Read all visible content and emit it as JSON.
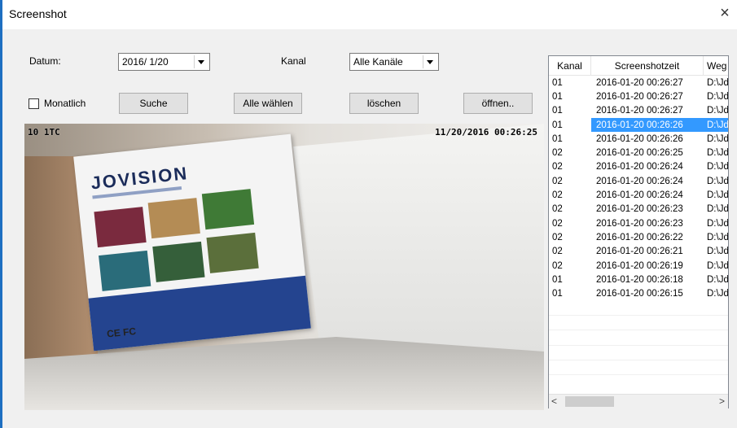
{
  "window": {
    "title": "Screenshot",
    "close_glyph": "×"
  },
  "filters": {
    "date_label": "Datum:",
    "date_value": "2016/ 1/20",
    "channel_label": "Kanal",
    "channel_value": "Alle Kanäle",
    "monthly_label": "Monatlich"
  },
  "buttons": {
    "search": "Suche",
    "select_all": "Alle wählen",
    "delete": "löschen",
    "open": "öffnen.."
  },
  "preview": {
    "osd_left": "10 1TC",
    "osd_right": "11/20/2016 00:26:25",
    "box_brand": "JOVISION",
    "box_marks": "CE FC"
  },
  "table": {
    "columns": [
      "Kanal",
      "Screenshotzeit",
      "Weg"
    ],
    "rows": [
      {
        "channel": "01",
        "time": "2016-01-20 00:26:27",
        "path": "D:\\Jd"
      },
      {
        "channel": "01",
        "time": "2016-01-20 00:26:27",
        "path": "D:\\Jd"
      },
      {
        "channel": "01",
        "time": "2016-01-20 00:26:27",
        "path": "D:\\Jd"
      },
      {
        "channel": "01",
        "time": "2016-01-20 00:26:26",
        "path": "D:\\Jd"
      },
      {
        "channel": "01",
        "time": "2016-01-20 00:26:26",
        "path": "D:\\Jd"
      },
      {
        "channel": "02",
        "time": "2016-01-20 00:26:25",
        "path": "D:\\Jd"
      },
      {
        "channel": "02",
        "time": "2016-01-20 00:26:24",
        "path": "D:\\Jd"
      },
      {
        "channel": "02",
        "time": "2016-01-20 00:26:24",
        "path": "D:\\Jd"
      },
      {
        "channel": "02",
        "time": "2016-01-20 00:26:24",
        "path": "D:\\Jd"
      },
      {
        "channel": "02",
        "time": "2016-01-20 00:26:23",
        "path": "D:\\Jd"
      },
      {
        "channel": "02",
        "time": "2016-01-20 00:26:23",
        "path": "D:\\Jd"
      },
      {
        "channel": "02",
        "time": "2016-01-20 00:26:22",
        "path": "D:\\Jd"
      },
      {
        "channel": "02",
        "time": "2016-01-20 00:26:21",
        "path": "D:\\Jd"
      },
      {
        "channel": "02",
        "time": "2016-01-20 00:26:19",
        "path": "D:\\Jd"
      },
      {
        "channel": "01",
        "time": "2016-01-20 00:26:18",
        "path": "D:\\Jd"
      },
      {
        "channel": "01",
        "time": "2016-01-20 00:26:15",
        "path": "D:\\Jd"
      }
    ],
    "selected_row_number": 4,
    "scroll_left": "<",
    "scroll_right": ">"
  },
  "colors": {
    "selection": "#3399ff",
    "window_bg": "#f0f0f0",
    "accent_edge": "#1e6fc1"
  }
}
